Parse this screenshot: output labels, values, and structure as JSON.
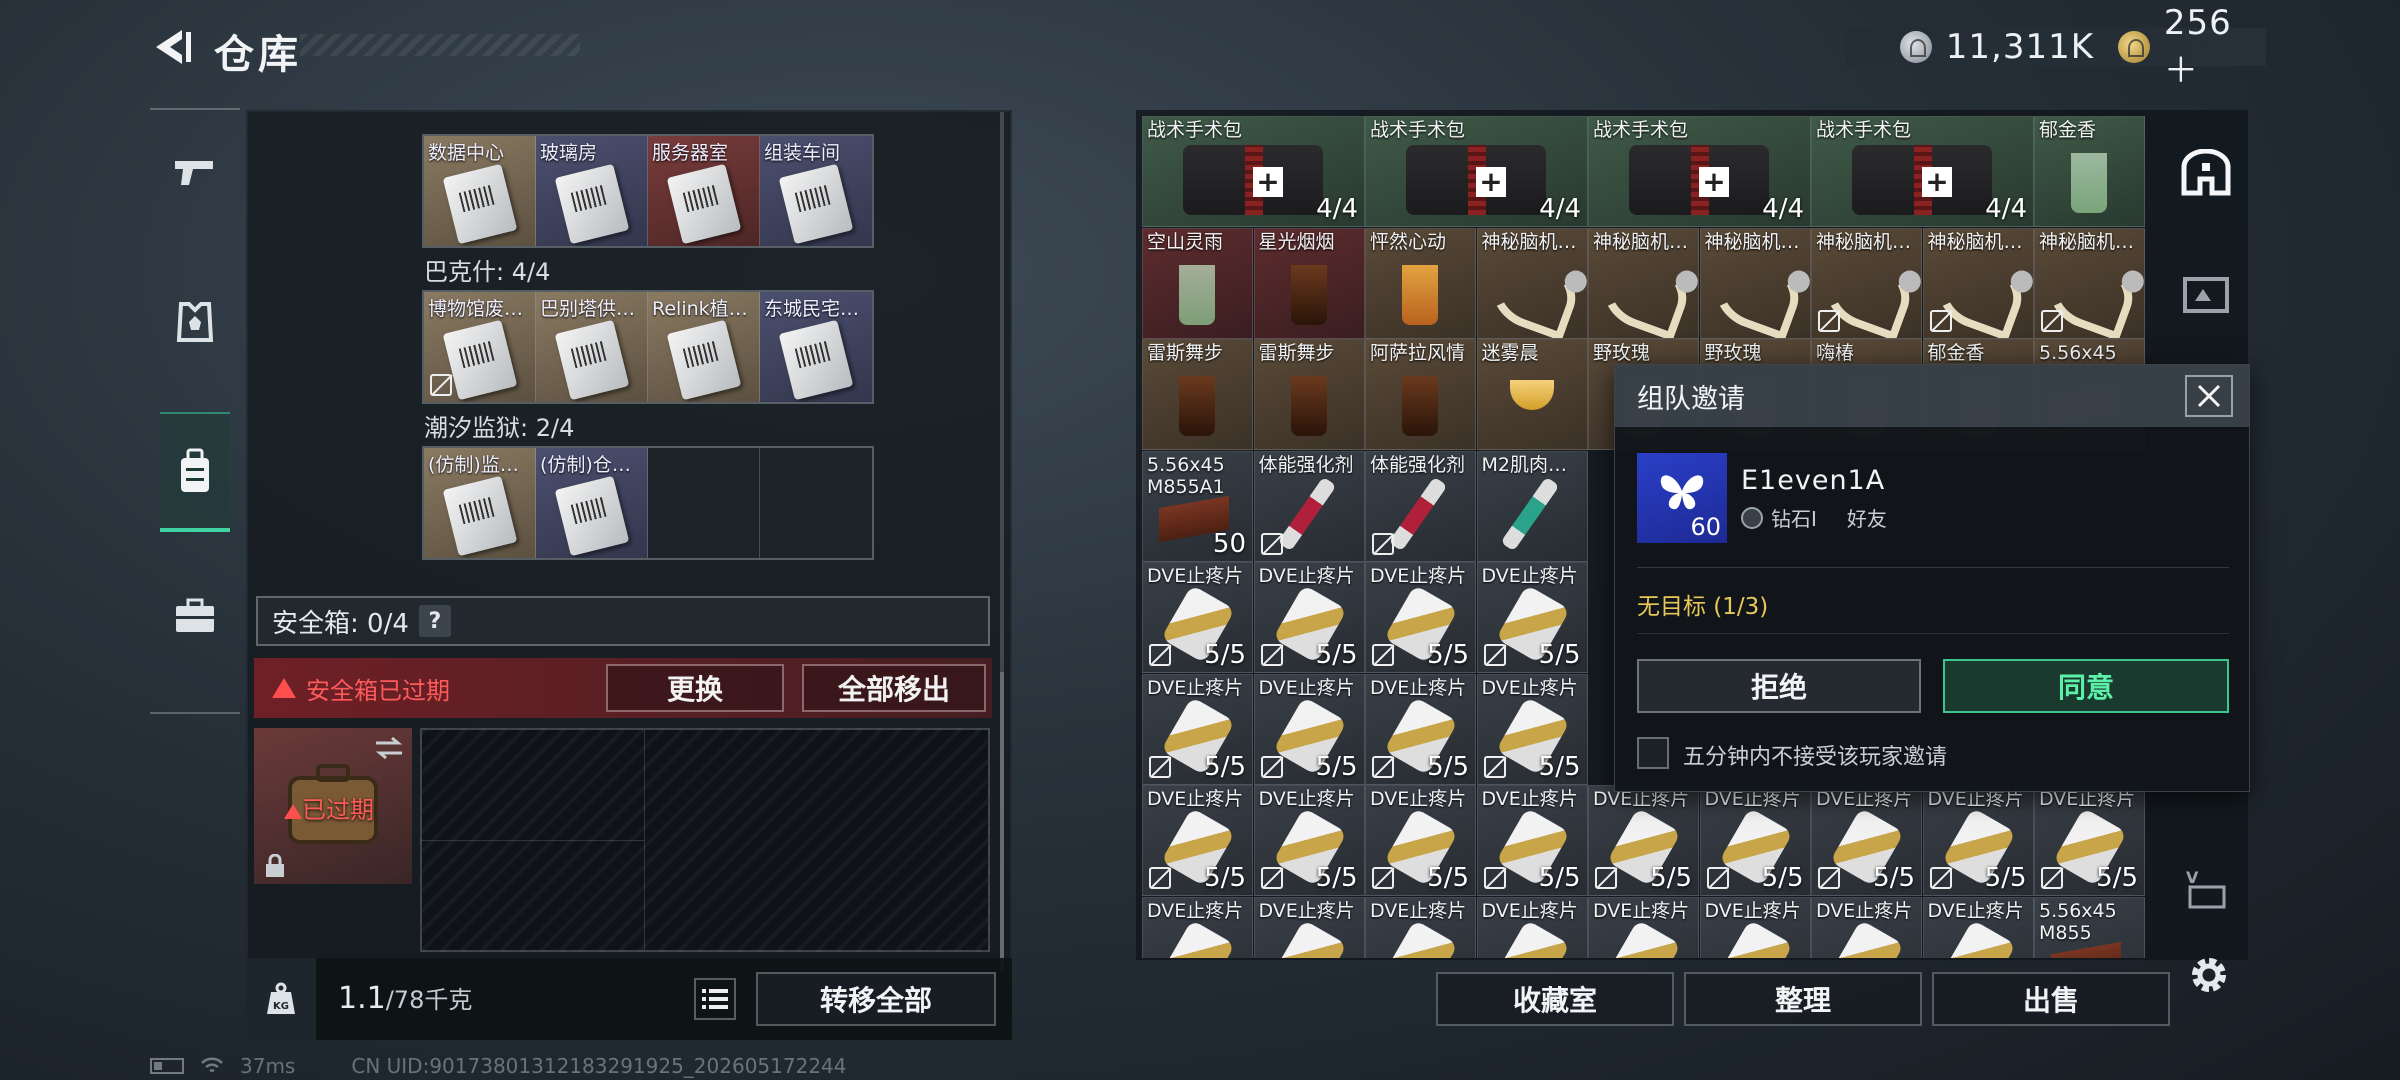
{
  "header": {
    "title": "仓库"
  },
  "currency": {
    "money": "11,311K",
    "points": "256＋"
  },
  "left_nav": {
    "items": [
      {
        "name": "weapons",
        "icon": "gun-icon"
      },
      {
        "name": "gear",
        "icon": "vest-icon"
      },
      {
        "name": "backpack",
        "icon": "backpack-icon"
      },
      {
        "name": "case",
        "icon": "briefcase-icon"
      }
    ]
  },
  "key_groups": [
    {
      "label": "",
      "slots": [
        {
          "name": "数据中心",
          "color": "beige"
        },
        {
          "name": "玻璃房",
          "color": "blue"
        },
        {
          "name": "服务器室",
          "color": "red"
        },
        {
          "name": "组装车间",
          "color": "blue"
        }
      ]
    },
    {
      "label": "巴克什: 4/4",
      "slots": [
        {
          "name": "博物馆废…",
          "color": "beige",
          "no_trade": true
        },
        {
          "name": "巴别塔供…",
          "color": "beige"
        },
        {
          "name": "Relink植…",
          "color": "beige"
        },
        {
          "name": "东城民宅…",
          "color": "blue"
        }
      ]
    },
    {
      "label": "潮汐监狱: 2/4",
      "slots": [
        {
          "name": "(仿制)监…",
          "color": "beige"
        },
        {
          "name": "(仿制)仓…",
          "color": "blue"
        },
        {
          "name": "",
          "color": "empty"
        },
        {
          "name": "",
          "color": "empty"
        }
      ]
    }
  ],
  "safe_box": {
    "label": "安全箱: 0/4",
    "help": "?",
    "expired_warning": "安全箱已过期",
    "replace_label": "更换",
    "remove_all_label": "全部移出",
    "case_status": "已过期"
  },
  "inventory_footer": {
    "weight_current": "1.1",
    "weight_max": "/78千克",
    "transfer_all_label": "转移全部"
  },
  "stash_items": [
    {
      "name": "战术手术包",
      "count": "4/4",
      "art": "kit",
      "bg": "green",
      "col": 0,
      "row": 0,
      "w": 2
    },
    {
      "name": "战术手术包",
      "count": "4/4",
      "art": "kit",
      "bg": "green",
      "col": 2,
      "row": 0,
      "w": 2
    },
    {
      "name": "战术手术包",
      "count": "4/4",
      "art": "kit",
      "bg": "green",
      "col": 4,
      "row": 0,
      "w": 2
    },
    {
      "name": "战术手术包",
      "count": "4/4",
      "art": "kit",
      "bg": "green",
      "col": 6,
      "row": 0,
      "w": 2
    },
    {
      "name": "郁金香",
      "count": "",
      "art": "g1",
      "bg": "green",
      "col": 8,
      "row": 0,
      "w": 1
    },
    {
      "name": "空山灵雨",
      "count": "",
      "art": "g1",
      "bg": "red",
      "col": 0,
      "row": 1,
      "w": 1
    },
    {
      "name": "星光烟烟",
      "count": "",
      "art": "g2",
      "bg": "red",
      "col": 1,
      "row": 1,
      "w": 1
    },
    {
      "name": "怦然心动",
      "count": "",
      "art": "g3",
      "bg": "brown",
      "col": 2,
      "row": 1,
      "w": 1
    },
    {
      "name": "神秘脑机…",
      "count": "",
      "art": "neuro",
      "bg": "brown",
      "col": 3,
      "row": 1,
      "w": 1
    },
    {
      "name": "神秘脑机…",
      "count": "",
      "art": "neuro",
      "bg": "brown",
      "col": 4,
      "row": 1,
      "w": 1
    },
    {
      "name": "神秘脑机…",
      "count": "",
      "art": "neuro",
      "bg": "brown",
      "col": 5,
      "row": 1,
      "w": 1
    },
    {
      "name": "神秘脑机…",
      "count": "",
      "art": "neuro",
      "bg": "brown",
      "col": 6,
      "row": 1,
      "w": 1,
      "no_trade": true
    },
    {
      "name": "神秘脑机…",
      "count": "",
      "art": "neuro",
      "bg": "brown",
      "col": 7,
      "row": 1,
      "w": 1,
      "no_trade": true
    },
    {
      "name": "神秘脑机…",
      "count": "",
      "art": "neuro",
      "bg": "brown",
      "col": 8,
      "row": 1,
      "w": 1,
      "no_trade": true
    },
    {
      "name": "雷斯舞步",
      "count": "",
      "art": "g2",
      "bg": "brown",
      "col": 0,
      "row": 2,
      "w": 1
    },
    {
      "name": "雷斯舞步",
      "count": "",
      "art": "g2",
      "bg": "brown",
      "col": 1,
      "row": 2,
      "w": 1
    },
    {
      "name": "阿萨拉风情",
      "count": "",
      "art": "g2",
      "bg": "brown",
      "col": 2,
      "row": 2,
      "w": 1
    },
    {
      "name": "迷雾晨",
      "count": "",
      "art": "g4",
      "bg": "brown",
      "col": 3,
      "row": 2,
      "w": 1
    },
    {
      "name": "野玫瑰",
      "count": "",
      "art": "g1",
      "bg": "brown",
      "col": 4,
      "row": 2,
      "w": 1
    },
    {
      "name": "野玫瑰",
      "count": "",
      "art": "g1",
      "bg": "brown",
      "col": 5,
      "row": 2,
      "w": 1
    },
    {
      "name": "嗨椿",
      "count": "",
      "art": "g1",
      "bg": "brown",
      "col": 6,
      "row": 2,
      "w": 1
    },
    {
      "name": "郁金香",
      "count": "",
      "art": "g1",
      "bg": "brown",
      "col": 7,
      "row": 2,
      "w": 1
    },
    {
      "name": "5.56x45",
      "count": "",
      "art": "ammo",
      "bg": "brown",
      "col": 8,
      "row": 2,
      "w": 1
    },
    {
      "name": "5.56x45 M855A1",
      "count": "50",
      "art": "ammo",
      "bg": "gray",
      "col": 0,
      "row": 3,
      "w": 1
    },
    {
      "name": "体能强化剂",
      "count": "",
      "art": "inj",
      "bg": "gray",
      "col": 1,
      "row": 3,
      "w": 1,
      "no_trade": true
    },
    {
      "name": "体能强化剂",
      "count": "",
      "art": "inj",
      "bg": "gray",
      "col": 2,
      "row": 3,
      "w": 1,
      "no_trade": true
    },
    {
      "name": "M2肌肉…",
      "count": "",
      "art": "inj-teal",
      "bg": "gray",
      "col": 3,
      "row": 3,
      "w": 1
    },
    {
      "name": "DVE止疼片",
      "count": "5/5",
      "art": "pill",
      "bg": "gray",
      "col": 0,
      "row": 4,
      "w": 1,
      "no_trade": true
    },
    {
      "name": "DVE止疼片",
      "count": "5/5",
      "art": "pill",
      "bg": "gray",
      "col": 1,
      "row": 4,
      "w": 1,
      "no_trade": true
    },
    {
      "name": "DVE止疼片",
      "count": "5/5",
      "art": "pill",
      "bg": "gray",
      "col": 2,
      "row": 4,
      "w": 1,
      "no_trade": true
    },
    {
      "name": "DVE止疼片",
      "count": "5/5",
      "art": "pill",
      "bg": "gray",
      "col": 3,
      "row": 4,
      "w": 1,
      "no_trade": true
    },
    {
      "name": "DVE止疼片",
      "count": "5/5",
      "art": "pill",
      "bg": "gray",
      "col": 0,
      "row": 5,
      "w": 1,
      "no_trade": true
    },
    {
      "name": "DVE止疼片",
      "count": "5/5",
      "art": "pill",
      "bg": "gray",
      "col": 1,
      "row": 5,
      "w": 1,
      "no_trade": true
    },
    {
      "name": "DVE止疼片",
      "count": "5/5",
      "art": "pill",
      "bg": "gray",
      "col": 2,
      "row": 5,
      "w": 1,
      "no_trade": true
    },
    {
      "name": "DVE止疼片",
      "count": "5/5",
      "art": "pill",
      "bg": "gray",
      "col": 3,
      "row": 5,
      "w": 1,
      "no_trade": true
    },
    {
      "name": "DVE止疼片",
      "count": "5/5",
      "art": "pill",
      "bg": "gray",
      "col": 0,
      "row": 6,
      "w": 1,
      "no_trade": true
    },
    {
      "name": "DVE止疼片",
      "count": "5/5",
      "art": "pill",
      "bg": "gray",
      "col": 1,
      "row": 6,
      "w": 1,
      "no_trade": true
    },
    {
      "name": "DVE止疼片",
      "count": "5/5",
      "art": "pill",
      "bg": "gray",
      "col": 2,
      "row": 6,
      "w": 1,
      "no_trade": true
    },
    {
      "name": "DVE止疼片",
      "count": "5/5",
      "art": "pill",
      "bg": "gray",
      "col": 3,
      "row": 6,
      "w": 1,
      "no_trade": true
    },
    {
      "name": "DVE止疼片",
      "count": "5/5",
      "art": "pill",
      "bg": "gray",
      "col": 4,
      "row": 6,
      "w": 1,
      "no_trade": true
    },
    {
      "name": "DVE止疼片",
      "count": "5/5",
      "art": "pill",
      "bg": "gray",
      "col": 5,
      "row": 6,
      "w": 1,
      "no_trade": true
    },
    {
      "name": "DVE止疼片",
      "count": "5/5",
      "art": "pill",
      "bg": "gray",
      "col": 6,
      "row": 6,
      "w": 1,
      "no_trade": true
    },
    {
      "name": "DVE止疼片",
      "count": "5/5",
      "art": "pill",
      "bg": "gray",
      "col": 7,
      "row": 6,
      "w": 1,
      "no_trade": true
    },
    {
      "name": "DVE止疼片",
      "count": "5/5",
      "art": "pill",
      "bg": "gray",
      "col": 8,
      "row": 6,
      "w": 1,
      "no_trade": true
    },
    {
      "name": "DVE止疼片",
      "count": "",
      "art": "pill",
      "bg": "gray",
      "col": 0,
      "row": 7,
      "w": 1
    },
    {
      "name": "DVE止疼片",
      "count": "",
      "art": "pill",
      "bg": "gray",
      "col": 1,
      "row": 7,
      "w": 1
    },
    {
      "name": "DVE止疼片",
      "count": "",
      "art": "pill",
      "bg": "gray",
      "col": 2,
      "row": 7,
      "w": 1
    },
    {
      "name": "DVE止疼片",
      "count": "",
      "art": "pill",
      "bg": "gray",
      "col": 3,
      "row": 7,
      "w": 1
    },
    {
      "name": "DVE止疼片",
      "count": "",
      "art": "pill",
      "bg": "gray",
      "col": 4,
      "row": 7,
      "w": 1
    },
    {
      "name": "DVE止疼片",
      "count": "",
      "art": "pill",
      "bg": "gray",
      "col": 5,
      "row": 7,
      "w": 1
    },
    {
      "name": "DVE止疼片",
      "count": "",
      "art": "pill",
      "bg": "gray",
      "col": 6,
      "row": 7,
      "w": 1
    },
    {
      "name": "DVE止疼片",
      "count": "",
      "art": "pill",
      "bg": "gray",
      "col": 7,
      "row": 7,
      "w": 1
    },
    {
      "name": "5.56x45 M855",
      "count": "",
      "art": "ammo",
      "bg": "gray",
      "col": 8,
      "row": 7,
      "w": 1
    }
  ],
  "stash_footer": {
    "collection_label": "收藏室",
    "sort_label": "整理",
    "sell_label": "出售"
  },
  "invite_dialog": {
    "title": "组队邀请",
    "player_name": "E1even1A",
    "player_level": "60",
    "player_rank": "钻石Ⅰ",
    "relation": "好友",
    "target_status": "无目标 (1/3)",
    "reject_label": "拒绝",
    "accept_label": "同意",
    "mute_label": "五分钟内不接受该玩家邀请"
  },
  "status_bar": {
    "ping": "37ms",
    "uid": "CN UID:90173801312183291925_202605172244"
  },
  "colors": {
    "accent_green": "#3fd3a2",
    "warning_red": "#ff5a5a",
    "target_yellow": "#e8c85a"
  }
}
